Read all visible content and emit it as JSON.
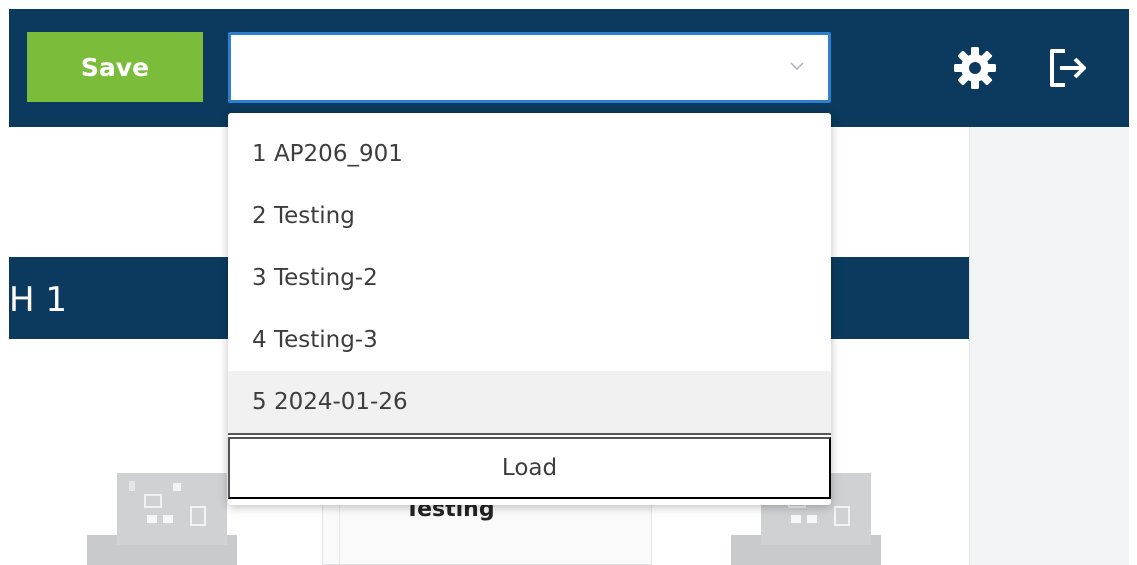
{
  "toolbar": {
    "save_label": "Save",
    "select_value": "",
    "settings_icon": "gear-icon",
    "logout_icon": "logout-icon"
  },
  "dropdown": {
    "options": [
      {
        "label": "1 AP206_901"
      },
      {
        "label": "2 Testing"
      },
      {
        "label": "3 Testing-2"
      },
      {
        "label": "4 Testing-3"
      },
      {
        "label": "5 2024-01-26",
        "highlighted": true
      }
    ],
    "load_label": "Load"
  },
  "background": {
    "band_label": "H 1",
    "card_label": "Testing"
  },
  "colors": {
    "header": "#0b3a5e",
    "save_button": "#7bbd3a",
    "select_border": "#2f7fd0",
    "highlight": "#f1f1f1"
  }
}
